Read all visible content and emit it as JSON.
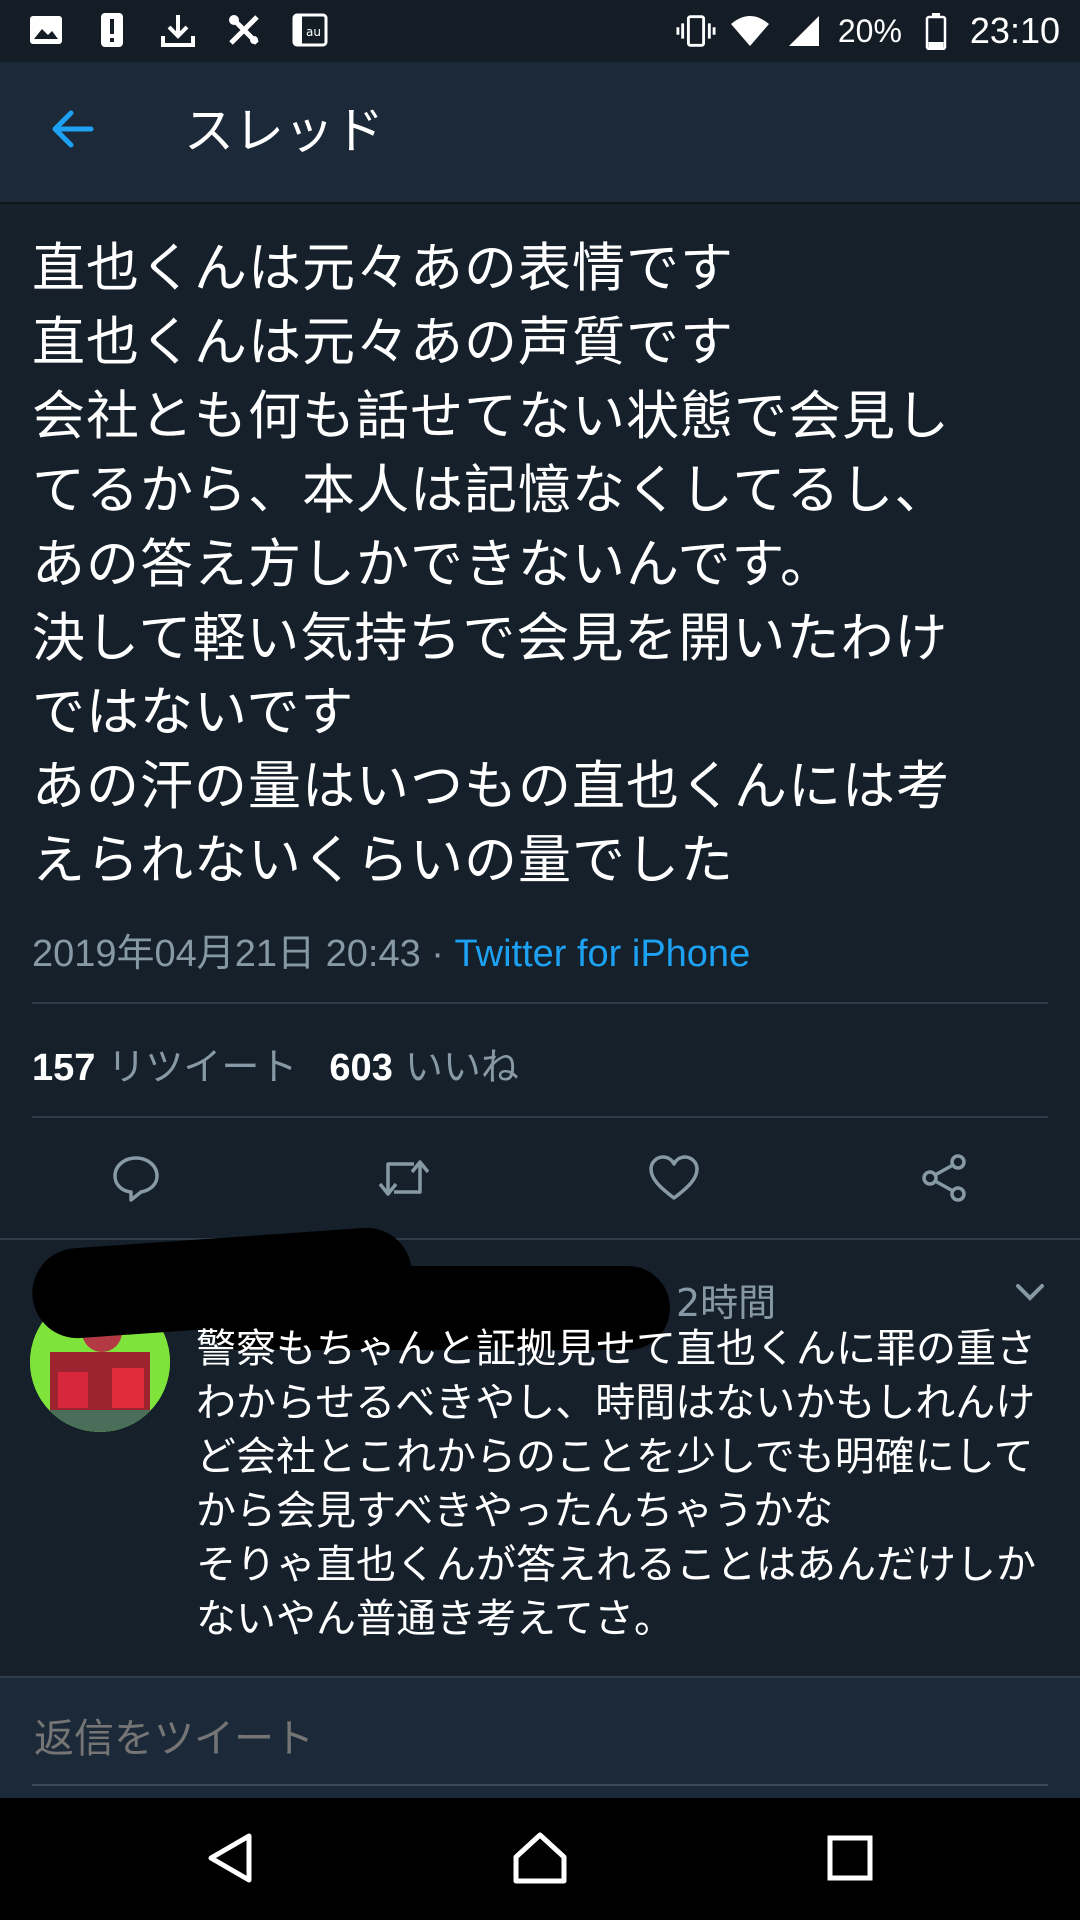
{
  "status_bar": {
    "icons_left": [
      "image-icon",
      "alert-icon",
      "download-icon",
      "tools-icon",
      "au-icon"
    ],
    "icons_right": [
      "vibrate-icon",
      "wifi-icon",
      "signal-icon"
    ],
    "battery": "20%",
    "time": "23:10"
  },
  "header": {
    "back_icon": "arrow-left-icon",
    "title": "スレッド"
  },
  "tweet": {
    "text": "直也くんは元々あの表情です\n直也くんは元々あの声質です\n会社とも何も話せてない状態で会見し\nてるから、本人は記憶なくしてるし、\nあの答え方しかできないんです。\n決して軽い気持ちで会見を開いたわけ\nではないです\nあの汗の量はいつもの直也くんには考\nえられないくらいの量でした",
    "datetime": "2019年04月21日 20:43",
    "separator": "·",
    "client": "Twitter for iPhone",
    "retweets_count": "157",
    "retweets_label": "リツイート",
    "likes_count": "603",
    "likes_label": "いいね"
  },
  "reply": {
    "time": "2時間",
    "text": "警察もちゃんと証拠見せて直也くんに罪の重さ\nわからせるべきやし、時間はないかもしれんけ\nど会社とこれからのことを少しでも明確にして\nから会見すべきやったんちゃうかな\nそりゃ直也くんが答えれることはあんだけしか\nないやん普通き考えてさ。"
  },
  "compose": {
    "placeholder": "返信をツイート"
  },
  "colors": {
    "background": "#15202b",
    "header": "#1c2938",
    "accent": "#1da1f2",
    "muted": "#8899a6"
  }
}
